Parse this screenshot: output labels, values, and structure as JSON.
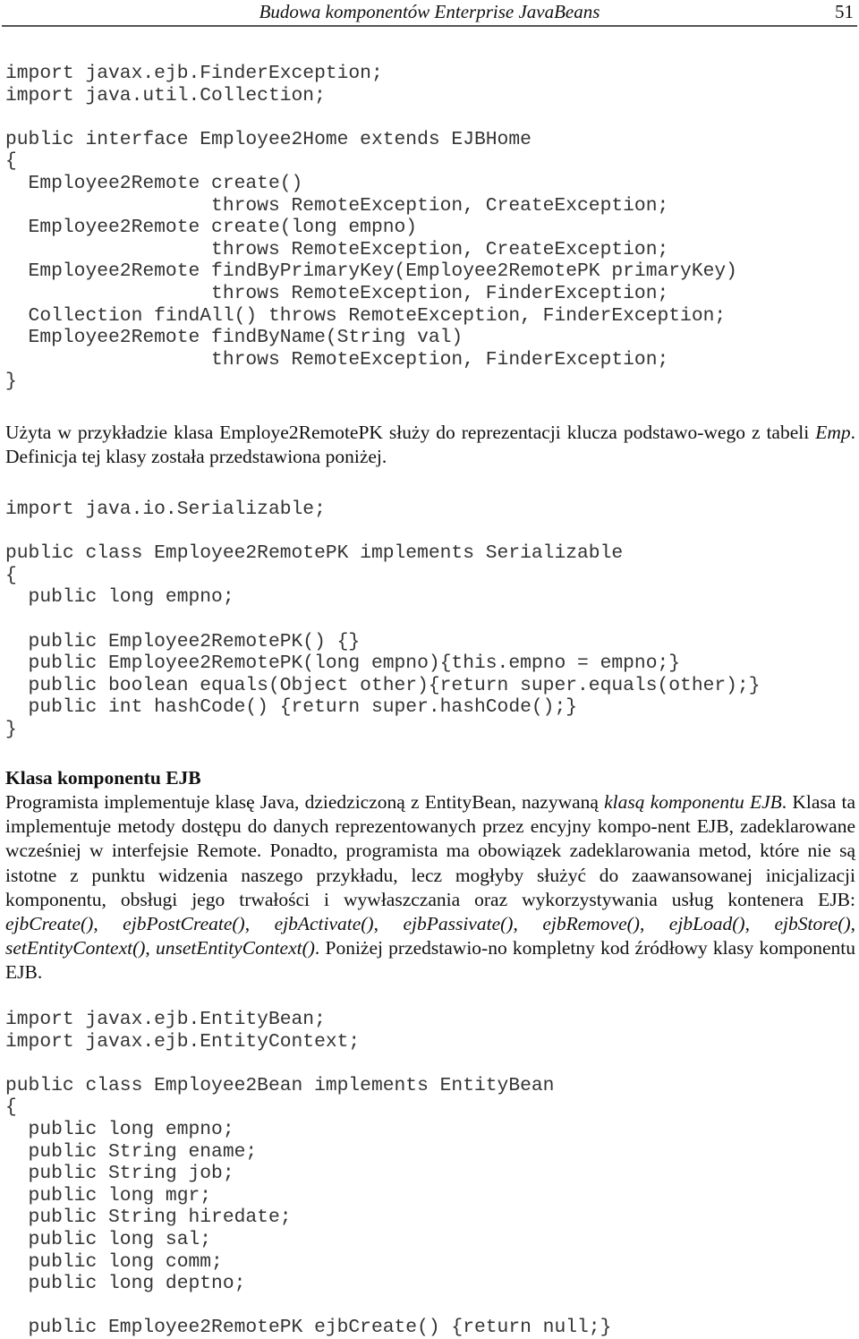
{
  "header": {
    "title": "Budowa komponentów Enterprise JavaBeans",
    "page_number": "51"
  },
  "code_block_1": [
    "import javax.ejb.FinderException;",
    "import java.util.Collection;",
    "",
    "public interface Employee2Home extends EJBHome",
    "{",
    "  Employee2Remote create()",
    "                  throws RemoteException, CreateException;",
    "  Employee2Remote create(long empno)",
    "                  throws RemoteException, CreateException;",
    "  Employee2Remote findByPrimaryKey(Employee2RemotePK primaryKey)",
    "                  throws RemoteException, FinderException;",
    "  Collection findAll() throws RemoteException, FinderException;",
    "  Employee2Remote findByName(String val)",
    "                  throws RemoteException, FinderException;",
    "}"
  ],
  "paragraph_1": {
    "part1": "Użyta w przykładzie klasa Employe2RemotePK służy do reprezentacji klucza podstawo-wego z tabeli ",
    "italic": "Emp",
    "part2": ". Definicja tej klasy została przedstawiona poniżej."
  },
  "code_block_2": [
    "import java.io.Serializable;",
    "",
    "public class Employee2RemotePK implements Serializable",
    "{",
    "  public long empno;",
    "",
    "  public Employee2RemotePK() {}",
    "  public Employee2RemotePK(long empno){this.empno = empno;}",
    "  public boolean equals(Object other){return super.equals(other);}",
    "  public int hashCode() {return super.hashCode();}",
    "}"
  ],
  "section": {
    "heading": "Klasa komponentu EJB",
    "p_a": "Programista implementuje klasę Java, dziedziczoną z EntityBean, nazywaną ",
    "p_b_italic": "klasą komponentu EJB",
    "p_c": ". Klasa ta implementuje metody dostępu do danych reprezentowanych przez encyjny kompo-nent EJB, zadeklarowane wcześniej w interfejsie Remote. Ponadto, programista ma obowiązek zadeklarowania metod, które nie są istotne z punktu widzenia naszego przykładu, lecz mogłyby służyć do zaawansowanej inicjalizacji komponentu, obsługi jego trwałości i wywłaszczania oraz wykorzystywania usług kontenera EJB: ",
    "methods": [
      "ejbCreate()",
      "ejbPostCreate()",
      "ejbActivate()",
      "ejbPassivate()",
      "ejbRemove()",
      "ejbLoad()",
      "ejbStore()",
      "setEntityContext()",
      "unsetEntityContext()"
    ],
    "p_d": ". Poniżej przedstawio-no kompletny kod źródłowy klasy komponentu EJB."
  },
  "code_block_3": [
    "import javax.ejb.EntityBean;",
    "import javax.ejb.EntityContext;",
    "",
    "public class Employee2Bean implements EntityBean",
    "{",
    "  public long empno;",
    "  public String ename;",
    "  public String job;",
    "  public long mgr;",
    "  public String hiredate;",
    "  public long sal;",
    "  public long comm;",
    "  public long deptno;",
    "",
    "  public Employee2RemotePK ejbCreate() {return null;}"
  ]
}
